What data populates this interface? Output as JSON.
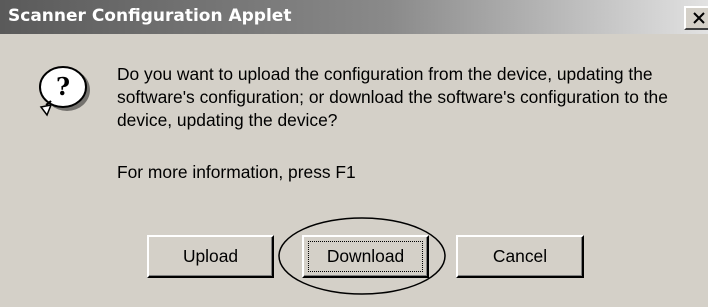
{
  "window": {
    "title": "Scanner Configuration Applet",
    "close_label": "×"
  },
  "message": {
    "text": "Do you want to upload the configuration from the device, updating the software's configuration; or download the software's configuration to the device, updating the device?",
    "help": "For more information, press F1",
    "icon": "question-icon"
  },
  "buttons": {
    "upload": "Upload",
    "download": "Download",
    "cancel": "Cancel"
  },
  "annotation": {
    "shape": "ellipse",
    "target": "download-button"
  }
}
